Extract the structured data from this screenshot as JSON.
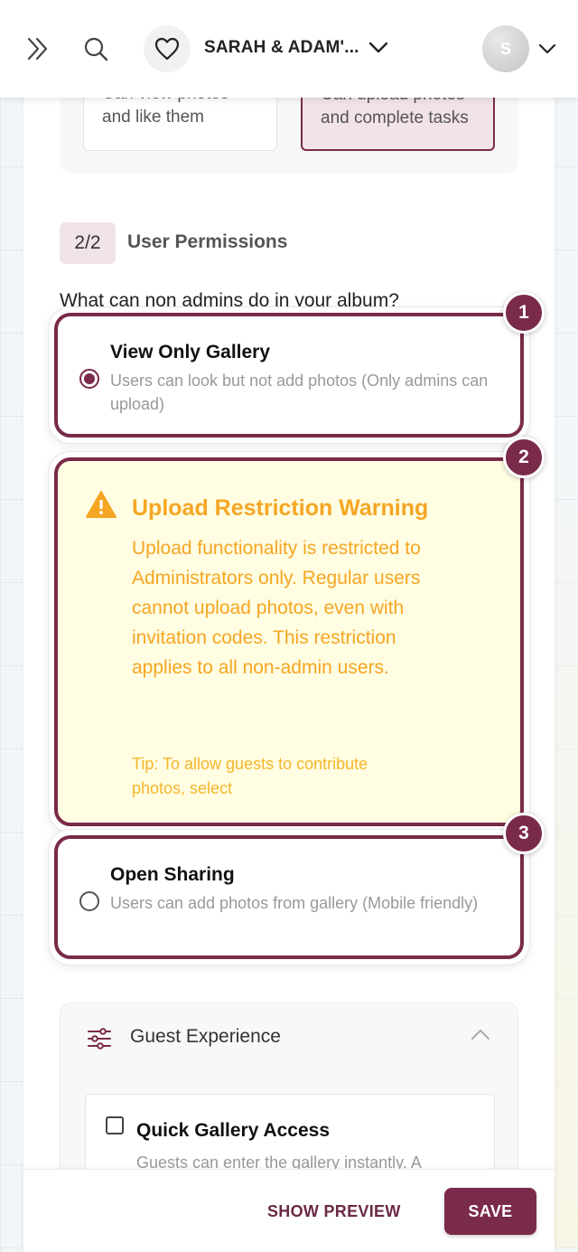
{
  "header": {
    "album_title": "SARAH & ADAM'...",
    "avatar_initial": "S",
    "icons": [
      "expand-icon",
      "search-icon",
      "heart-icon",
      "chevron-down-icon"
    ]
  },
  "roles": {
    "viewer_text_line1": "Can view photos",
    "viewer_text_line2": "and like them",
    "uploader_text_line1": "Can upload photos",
    "uploader_text_line2": "and complete tasks"
  },
  "step": {
    "badge": "2/2",
    "title": "User Permissions",
    "question": "What can non admins do in your album?"
  },
  "options": {
    "view_only": {
      "title": "View Only Gallery",
      "description": "Users can look but not add photos (Only admins can upload)",
      "selected": true,
      "badge": "1"
    },
    "open_sharing": {
      "title": "Open Sharing",
      "description": "Users can add photos from gallery (Mobile friendly)",
      "selected": false,
      "badge": "3"
    }
  },
  "warning": {
    "badge": "2",
    "title": "Upload Restriction Warning",
    "body": "Upload functionality is restricted to Administrators only. Regular users cannot upload photos, even with invitation codes. This restriction applies to all non-admin users.",
    "tip": "Tip: To allow guests to contribute photos, select"
  },
  "guest_experience": {
    "title": "Guest Experience",
    "quick_access_title": "Quick Gallery Access",
    "quick_access_desc": "Guests can enter the gallery instantly. A"
  },
  "footer": {
    "preview_label": "SHOW PREVIEW",
    "save_label": "SAVE"
  },
  "colors": {
    "brand": "#7a2a4a",
    "warning_text": "#f5a623",
    "warning_bg": "#fffde2"
  }
}
